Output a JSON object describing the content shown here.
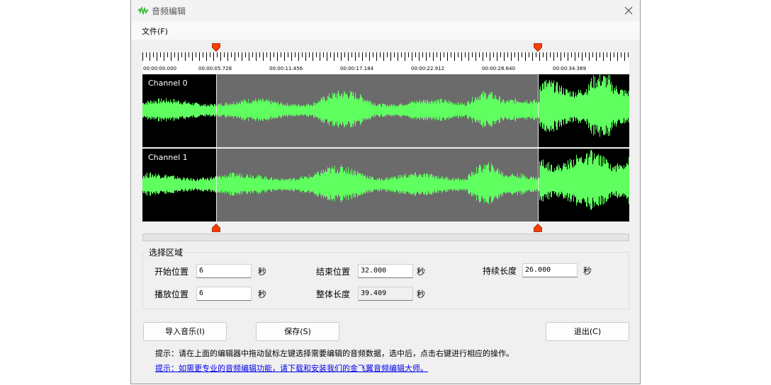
{
  "window": {
    "title": "音频编辑"
  },
  "menu": {
    "file": "文件(F)"
  },
  "ruler": {
    "labels": [
      "00:00:00.000",
      "00:00:05.728",
      "00:00:11.456",
      "00:00:17.184",
      "00:00:22.912",
      "00:00:28.640",
      "00:00:34.369"
    ]
  },
  "channels": [
    {
      "label": "Channel 0"
    },
    {
      "label": "Channel 1"
    }
  ],
  "selection": {
    "group_title": "选择区域",
    "start_label": "开始位置",
    "start_value": "6",
    "end_label": "结束位置",
    "end_value": "32.000",
    "duration_label": "持续长度",
    "duration_value": "26.000",
    "play_label": "播放位置",
    "play_value": "6",
    "total_label": "整体长度",
    "total_value": "39.409",
    "unit": "秒"
  },
  "buttons": {
    "import": "导入音乐(I)",
    "save": "保存(S)",
    "exit": "退出(C)"
  },
  "hints": {
    "line1": "提示：请在上面的编辑器中拖动鼠标左键选择需要编辑的音频数据，选中后，点击右键进行相应的操作。",
    "line2": "提示：如需更专业的音频编辑功能，请下载和安装我们的金飞翼音频编辑大师。"
  },
  "colors": {
    "wave": "#5fff5f",
    "selection_bg": "#6b6b6b",
    "marker": "#ff3c00"
  }
}
